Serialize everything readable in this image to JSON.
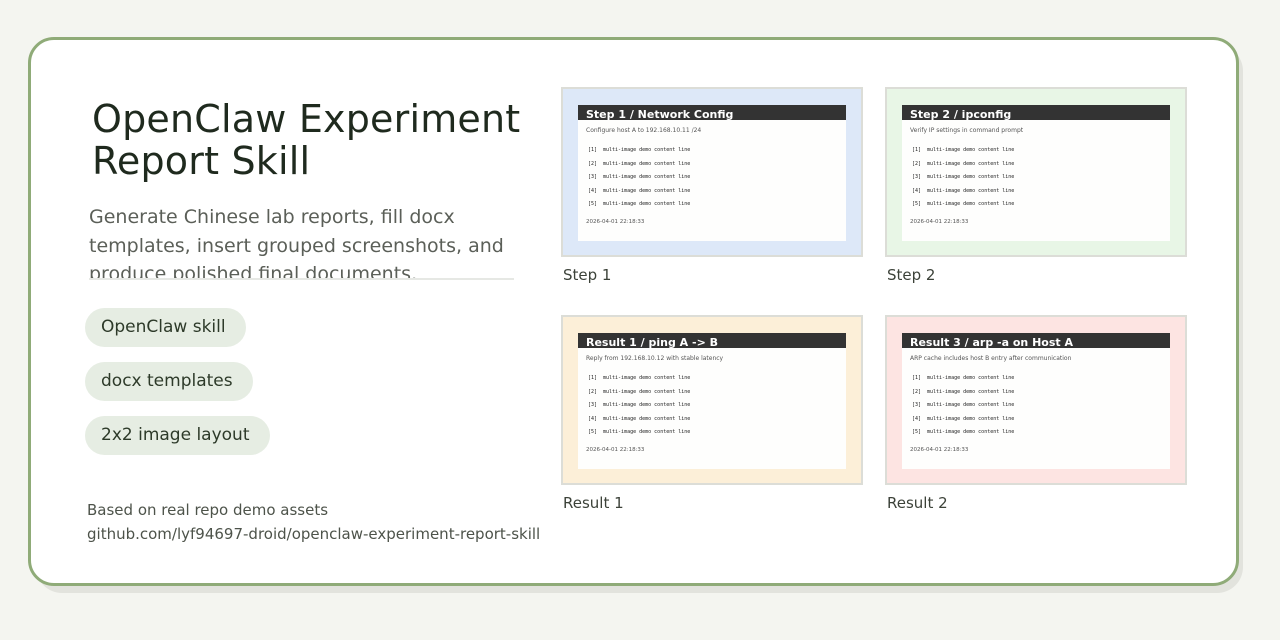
{
  "colors": {
    "background": "#f4f5f0",
    "card_border": "#8fab78",
    "tag_background": "#e6ede3",
    "thumb_step1": "#dde8f8",
    "thumb_step2": "#e8f6e6",
    "thumb_result1": "#fcefd8",
    "thumb_result2": "#fde4e2"
  },
  "title": "OpenClaw Experiment Report Skill",
  "subtitle": "Generate Chinese lab reports, fill docx templates, insert grouped screenshots, and produce polished final documents.",
  "tags": [
    "OpenClaw skill",
    "docx templates",
    "2x2 image layout"
  ],
  "footer": {
    "note": "Based on real repo demo assets",
    "repo": "github.com/lyf94697-droid/openclaw-experiment-report-skill"
  },
  "thumbnails": [
    {
      "heading": "Step 1 / Network Config",
      "description": "Configure host A to 192.168.10.11 /24",
      "lines": [
        {
          "num": "[1]",
          "text": "multi-image demo content line"
        },
        {
          "num": "[2]",
          "text": "multi-image demo content line"
        },
        {
          "num": "[3]",
          "text": "multi-image demo content line"
        },
        {
          "num": "[4]",
          "text": "multi-image demo content line"
        },
        {
          "num": "[5]",
          "text": "multi-image demo content line"
        }
      ],
      "timestamp": "2026-04-01 22:18:33",
      "caption": "Step 1"
    },
    {
      "heading": "Step 2 / ipconfig",
      "description": "Verify IP settings in command prompt",
      "lines": [
        {
          "num": "[1]",
          "text": "multi-image demo content line"
        },
        {
          "num": "[2]",
          "text": "multi-image demo content line"
        },
        {
          "num": "[3]",
          "text": "multi-image demo content line"
        },
        {
          "num": "[4]",
          "text": "multi-image demo content line"
        },
        {
          "num": "[5]",
          "text": "multi-image demo content line"
        }
      ],
      "timestamp": "2026-04-01 22:18:33",
      "caption": "Step 2"
    },
    {
      "heading": "Result 1 / ping A -> B",
      "description": "Reply from 192.168.10.12 with stable latency",
      "lines": [
        {
          "num": "[1]",
          "text": "multi-image demo content line"
        },
        {
          "num": "[2]",
          "text": "multi-image demo content line"
        },
        {
          "num": "[3]",
          "text": "multi-image demo content line"
        },
        {
          "num": "[4]",
          "text": "multi-image demo content line"
        },
        {
          "num": "[5]",
          "text": "multi-image demo content line"
        }
      ],
      "timestamp": "2026-04-01 22:18:33",
      "caption": "Result 1"
    },
    {
      "heading": "Result 3 / arp -a on Host A",
      "description": "ARP cache includes host B entry after communication",
      "lines": [
        {
          "num": "[1]",
          "text": "multi-image demo content line"
        },
        {
          "num": "[2]",
          "text": "multi-image demo content line"
        },
        {
          "num": "[3]",
          "text": "multi-image demo content line"
        },
        {
          "num": "[4]",
          "text": "multi-image demo content line"
        },
        {
          "num": "[5]",
          "text": "multi-image demo content line"
        }
      ],
      "timestamp": "2026-04-01 22:18:33",
      "caption": "Result 2"
    }
  ]
}
